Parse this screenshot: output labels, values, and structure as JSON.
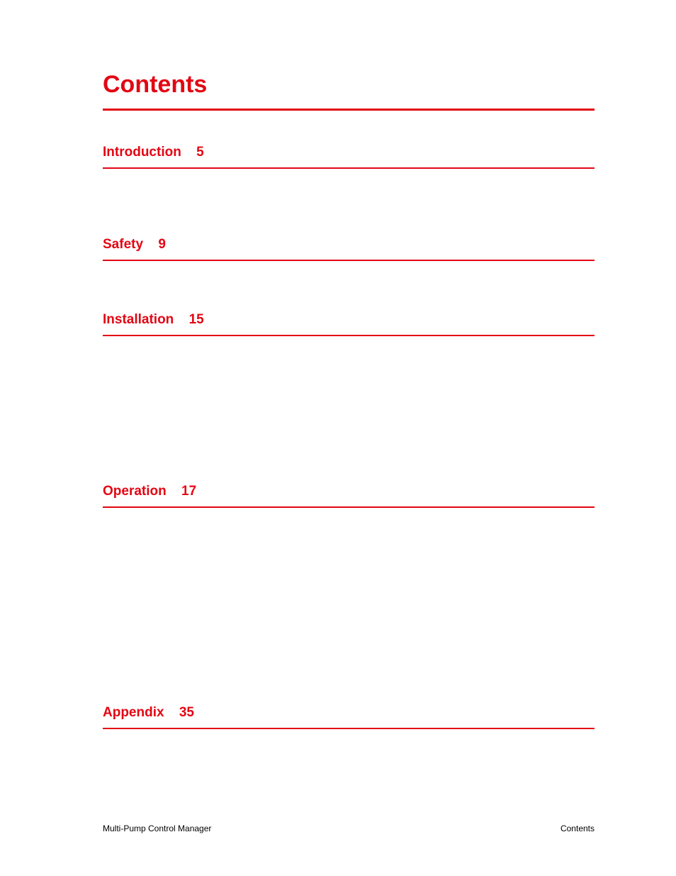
{
  "title": "Contents",
  "sections": [
    {
      "label": "Introduction",
      "page": "5"
    },
    {
      "label": "Safety",
      "page": "9"
    },
    {
      "label": "Installation",
      "page": "15"
    },
    {
      "label": "Operation",
      "page": "17"
    },
    {
      "label": "Appendix",
      "page": "35"
    }
  ],
  "footer": {
    "left": "Multi-Pump Control Manager",
    "right": "Contents"
  }
}
